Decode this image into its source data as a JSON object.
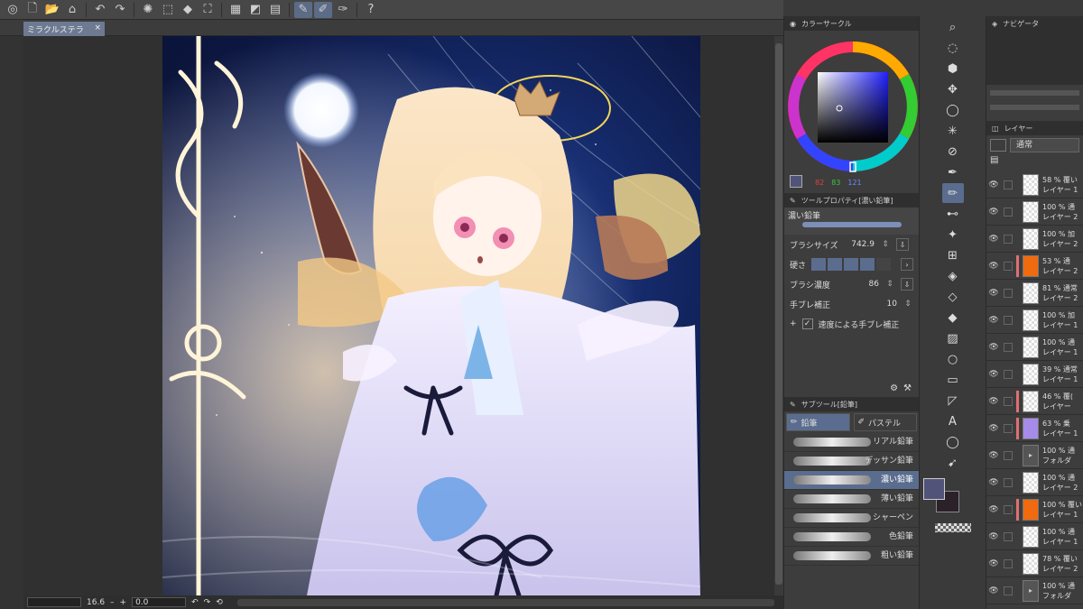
{
  "toolbar": {
    "icons": [
      "app-menu-icon",
      "new-file-icon",
      "open-folder-icon",
      "save-icon",
      "undo-icon",
      "redo-icon",
      "loading-spinner-icon",
      "transform-icon",
      "fill-icon",
      "crop-icon",
      "grid-icon",
      "layer-icon",
      "ruler-icon",
      "pen-brush-icon",
      "pen-stroke-icon",
      "pen-line-icon",
      "help-icon"
    ]
  },
  "document": {
    "tab_name": "ミラクルステラ",
    "close_glyph": "×"
  },
  "status": {
    "zoom": "16.6",
    "minus": "–",
    "plus": "+",
    "rotation": "0.0"
  },
  "color_panel": {
    "title": "カラーサークル",
    "r": "82",
    "g": "83",
    "b": "121",
    "accent": "#525379"
  },
  "tool_property": {
    "title": "ツールプロパティ[濃い鉛筆]",
    "brush_name": "濃い鉛筆",
    "brush_size_label": "ブラシサイズ",
    "brush_size": "742.9",
    "hardness_label": "硬さ",
    "density_label": "ブラシ濃度",
    "density": "86",
    "stabilization_label": "手ブレ補正",
    "stabilization": "10",
    "speed_stab_label": "速度による手ブレ補正"
  },
  "sub_tool": {
    "title": "サブツール[鉛筆]",
    "tabs": [
      "鉛筆",
      "パステル"
    ],
    "brushes": [
      "リアル鉛筆",
      "デッサン鉛筆",
      "濃い鉛筆",
      "薄い鉛筆",
      "シャーペン",
      "色鉛筆",
      "粗い鉛筆"
    ],
    "selected_index": 2
  },
  "navigator": {
    "title": "ナビゲータ"
  },
  "layer_panel": {
    "tab": "レイヤー",
    "blend_mode": "通常",
    "layers": [
      {
        "l1": "58 % 覆い",
        "l2": "レイヤー 1",
        "mark": ""
      },
      {
        "l1": "100 % 通",
        "l2": "レイヤー 2",
        "mark": ""
      },
      {
        "l1": "100 % 加",
        "l2": "レイヤー 2",
        "mark": ""
      },
      {
        "l1": "53 % 通",
        "l2": "レイヤー 2",
        "mark": "#e07070",
        "thumb": "#f06a10"
      },
      {
        "l1": "81 % 通常",
        "l2": "レイヤー 2",
        "mark": ""
      },
      {
        "l1": "100 % 加",
        "l2": "レイヤー 1",
        "mark": ""
      },
      {
        "l1": "100 % 通",
        "l2": "レイヤー 1",
        "mark": ""
      },
      {
        "l1": "39 % 通常",
        "l2": "レイヤー 1",
        "mark": ""
      },
      {
        "l1": "46 % 覆(",
        "l2": "レイヤー",
        "mark": "#e07070"
      },
      {
        "l1": "63 % 乗",
        "l2": "レイヤー 1",
        "mark": "#e07070",
        "thumb": "#a78be8"
      },
      {
        "l1": "100 % 通",
        "l2": "フォルダ",
        "mark": "",
        "folder": true
      },
      {
        "l1": "100 % 通",
        "l2": "レイヤー 2",
        "mark": ""
      },
      {
        "l1": "100 % 覆い",
        "l2": "レイヤー 1",
        "mark": "#e07070",
        "thumb": "#f06a10"
      },
      {
        "l1": "100 % 通",
        "l2": "レイヤー 1",
        "mark": ""
      },
      {
        "l1": "78 % 覆い",
        "l2": "レイヤー 2",
        "mark": ""
      },
      {
        "l1": "100 % 通",
        "l2": "フォルダ",
        "mark": "",
        "folder": true
      }
    ]
  },
  "colors": {
    "main": "#525379",
    "sub": "#2a2228"
  }
}
